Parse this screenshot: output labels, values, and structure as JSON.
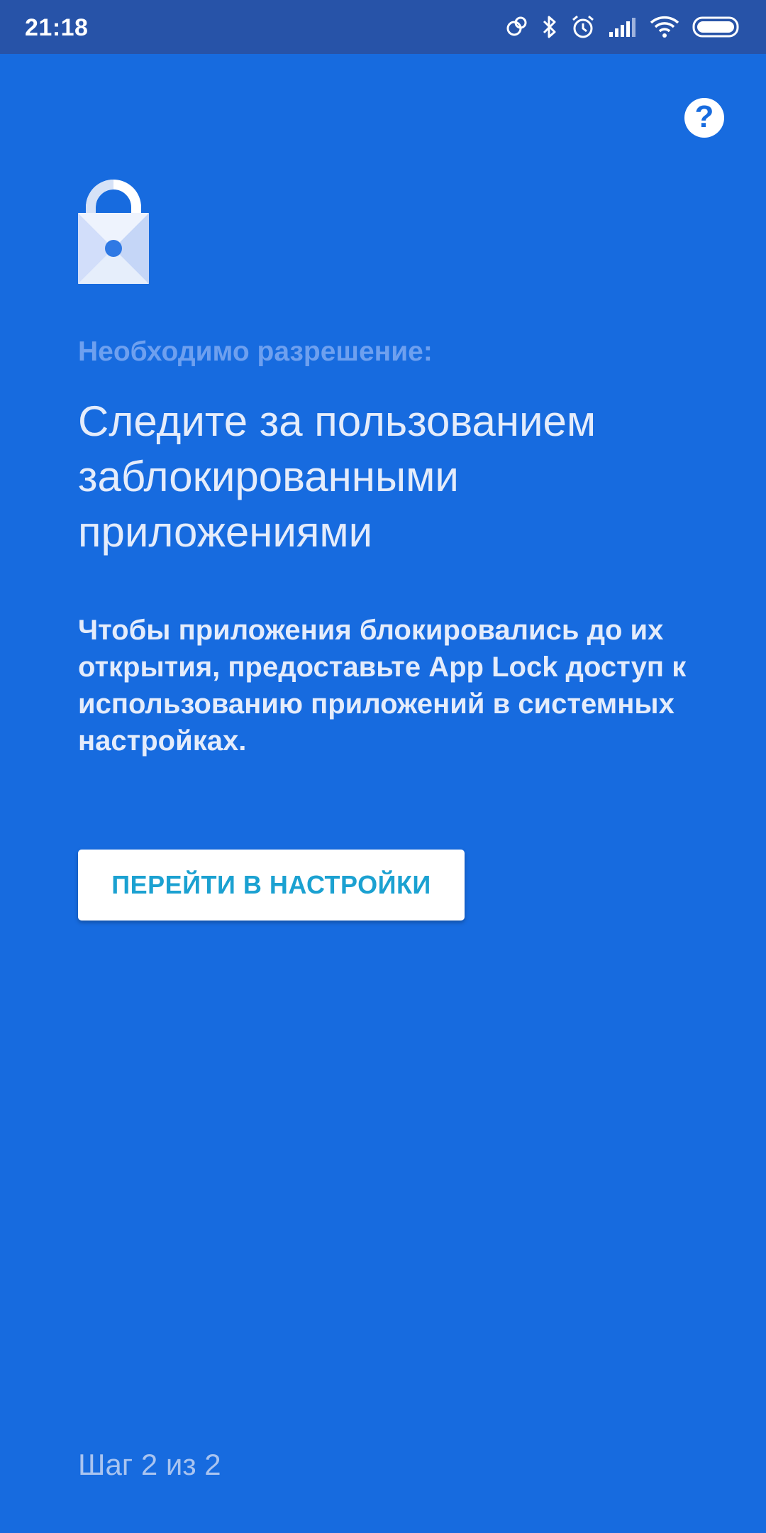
{
  "status_bar": {
    "time": "21:18",
    "icons": [
      "sync-icon",
      "bluetooth-icon",
      "alarm-icon",
      "signal-icon",
      "wifi-icon",
      "battery-icon"
    ]
  },
  "help": {
    "icon": "help-icon",
    "glyph": "?"
  },
  "lock": {
    "icon": "lock-icon"
  },
  "permission_label": "Необходимо разрешение:",
  "headline": "Следите за пользованием заблокированными приложениями",
  "description": "Чтобы приложения блокировались до их открытия, предоставьте App Lock доступ к использованию приложений в системных настройках.",
  "settings_button": {
    "label": "ПЕРЕЙТИ В НАСТРОЙКИ"
  },
  "step": "Шаг 2 из 2",
  "colors": {
    "background": "#176bdf",
    "status_bar": "#2753a8",
    "button_text": "#1ba1d1",
    "label": "#6ea0ef"
  }
}
